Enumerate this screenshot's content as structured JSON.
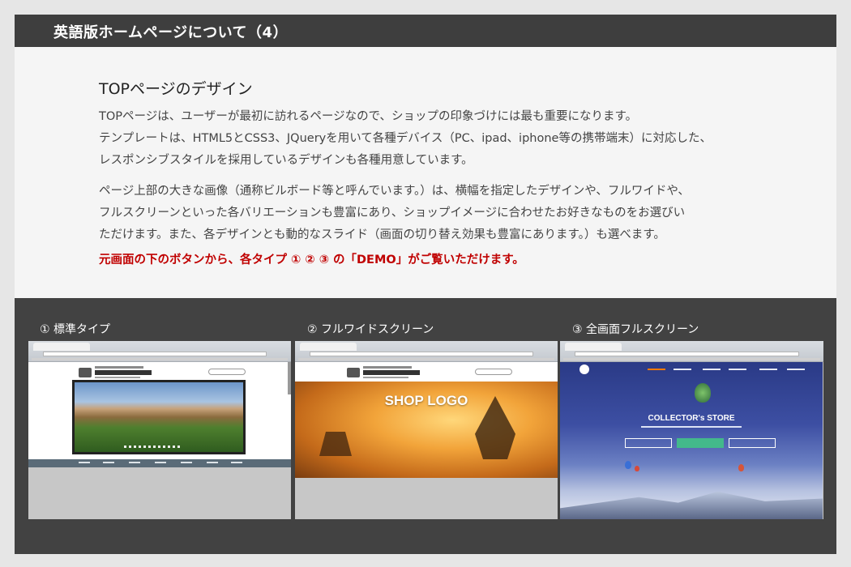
{
  "header": {
    "title": "英語版ホームページについて（4）"
  },
  "content": {
    "heading": "TOPページのデザイン",
    "para1": [
      "TOPページは、ユーザーが最初に訪れるページなので、ショップの印象づけには最も重要になります。",
      "テンプレートは、HTML5とCSS3、JQueryを用いて各種デバイス（PC、ipad、iphone等の携帯端末）に対応した、",
      "レスポンシブスタイルを採用しているデザインも各種用意しています。"
    ],
    "para2": [
      "ページ上部の大きな画像（通称ビルボード等と呼んでいます。）は、横幅を指定したデザインや、フルワイドや、",
      "フルスクリーンといった各バリエーションも豊富にあり、ショップイメージに合わせたお好きなものをお選びい",
      "ただけます。また、各デザインとも動的なスライド（画面の切り替え効果も豊富にあります。）も選べます。"
    ],
    "highlight": "元画面の下のボタンから、各タイプ ① ② ③ の「DEMO」がご覧いただけます。"
  },
  "demos": [
    {
      "label": "① 標準タイプ"
    },
    {
      "label": "② フルワイドスクリーン",
      "hero_text": "SHOP LOGO"
    },
    {
      "label": "③ 全画面フルスクリーン",
      "hero_text": "COLLECTOR's STORE"
    }
  ],
  "colors": {
    "header_bg": "#3e3e3e",
    "panel_bg": "#f5f5f5",
    "demo_bg": "#424242",
    "highlight": "#c00000"
  }
}
